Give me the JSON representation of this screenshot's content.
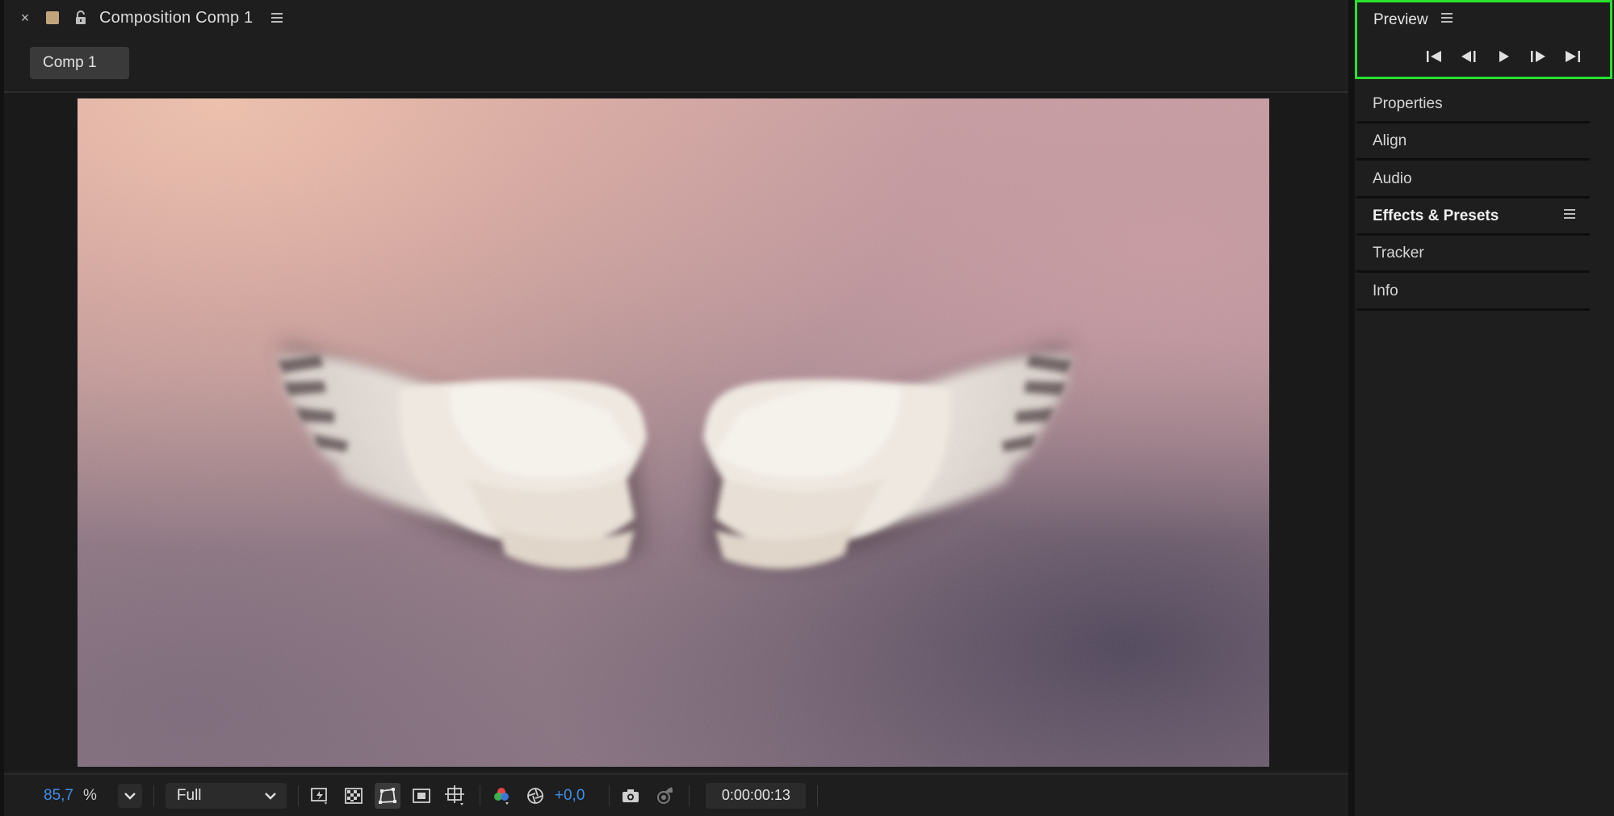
{
  "composition": {
    "close_glyph": "×",
    "swatch_color": "#c2a47c",
    "title": "Composition Comp 1",
    "tab_label": "Comp 1",
    "icons": [
      "close-icon",
      "lock-icon",
      "panel-menu-icon"
    ]
  },
  "viewer": {
    "content": "angel-wings-image"
  },
  "toolbar": {
    "zoom_value": "85,7",
    "zoom_unit": "%",
    "resolution": "Full",
    "exposure": "+0,0",
    "timecode": "0:00:00:13",
    "accent_color": "#3f8fe8",
    "icons": [
      "zoom-dropdown-icon",
      "fast-preview-icon",
      "transparency-grid-icon",
      "mask-path-visibility-icon",
      "region-of-interest-icon",
      "grid-guides-icon",
      "color-channels-icon",
      "color-management-icon",
      "snapshot-camera-icon",
      "show-snapshot-icon"
    ]
  },
  "right_panel": {
    "preview": {
      "title": "Preview",
      "highlight_color": "#28e12d",
      "controls": [
        "first-frame-icon",
        "previous-frame-icon",
        "play-icon",
        "next-frame-icon",
        "last-frame-icon"
      ]
    },
    "items": [
      {
        "label": "Properties"
      },
      {
        "label": "Align"
      },
      {
        "label": "Audio"
      },
      {
        "label": "Effects & Presets"
      },
      {
        "label": "Tracker"
      },
      {
        "label": "Info"
      }
    ]
  }
}
